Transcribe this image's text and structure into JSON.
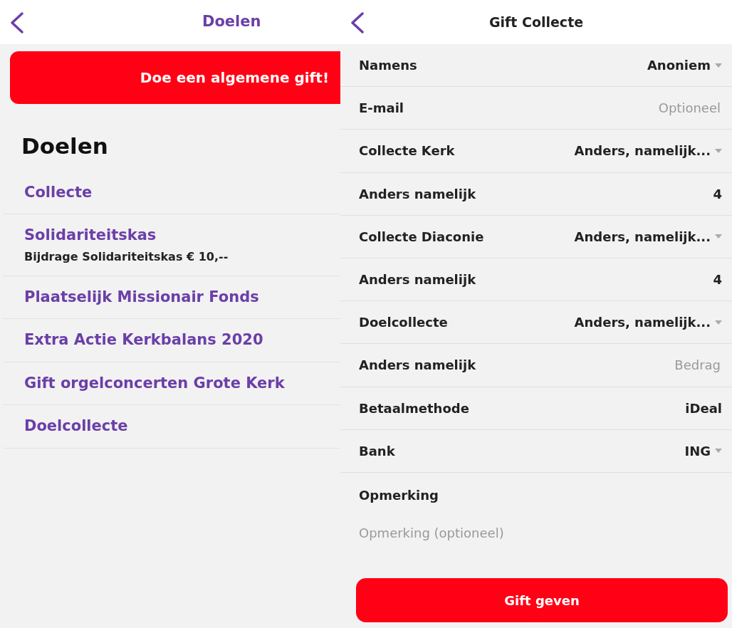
{
  "left_screen": {
    "title": "Doelen",
    "general_gift_button": "Doe een algemene gift!",
    "section_heading": "Doelen",
    "items": [
      {
        "title": "Collecte"
      },
      {
        "title": "Solidariteitskas",
        "subtitle": "Bijdrage Solidariteitskas € 10,--"
      },
      {
        "title": "Plaatselijk Missionair Fonds"
      },
      {
        "title": "Extra Actie Kerkbalans 2020"
      },
      {
        "title": "Gift orgelconcerten Grote Kerk"
      },
      {
        "title": "Doelcollecte"
      }
    ]
  },
  "right_screen": {
    "title": "Gift Collecte",
    "fields": [
      {
        "kind": "select",
        "label": "Namens",
        "value": "Anoniem"
      },
      {
        "kind": "input",
        "label": "E-mail",
        "placeholder": "Optioneel"
      },
      {
        "kind": "select",
        "label": "Collecte Kerk",
        "value": "Anders, namelijk..."
      },
      {
        "kind": "value",
        "label": "Anders namelijk",
        "value": "4"
      },
      {
        "kind": "select",
        "label": "Collecte Diaconie",
        "value": "Anders, namelijk..."
      },
      {
        "kind": "value",
        "label": "Anders namelijk",
        "value": "4"
      },
      {
        "kind": "select",
        "label": "Doelcollecte",
        "value": "Anders, namelijk..."
      },
      {
        "kind": "input",
        "label": "Anders namelijk",
        "placeholder": "Bedrag"
      },
      {
        "kind": "value",
        "label": "Betaalmethode",
        "value": "iDeal"
      },
      {
        "kind": "select",
        "label": "Bank",
        "value": "ING"
      }
    ],
    "remark": {
      "label": "Opmerking",
      "placeholder": "Opmerking (optioneel)"
    },
    "submit_button": "Gift geven"
  }
}
